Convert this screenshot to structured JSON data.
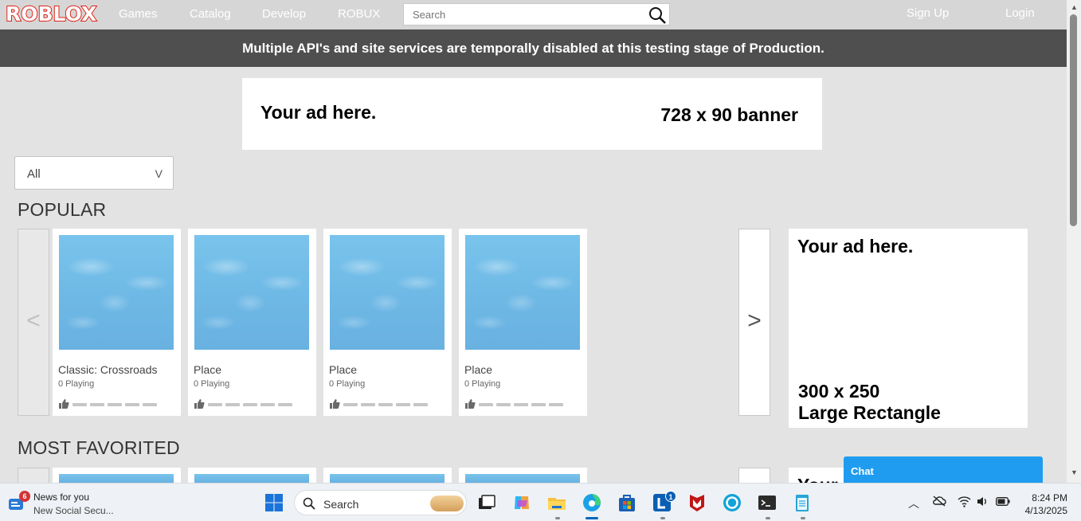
{
  "nav": {
    "logo": "ROBLOX",
    "links": [
      "Games",
      "Catalog",
      "Develop",
      "ROBUX"
    ],
    "search_placeholder": "Search",
    "signup": "Sign Up",
    "login": "Login"
  },
  "alert": "Multiple API's and site services are temporally disabled at this testing stage of Production.",
  "ad_banner": {
    "line1": "Your ad here.",
    "line2": "728 x 90 banner"
  },
  "ad_rect": {
    "line1": "Your ad here.",
    "line2": "300 x 250",
    "line3": "Large Rectangle"
  },
  "ad_rect2": {
    "line1": "Your ad here."
  },
  "filter": {
    "value": "All",
    "chevron": "V"
  },
  "sections": [
    {
      "title": "POPULAR",
      "prev": "<",
      "next": ">",
      "cards": [
        {
          "name": "Classic: Crossroads",
          "players": "0 Playing"
        },
        {
          "name": "Place",
          "players": "0 Playing"
        },
        {
          "name": "Place",
          "players": "0 Playing"
        },
        {
          "name": "Place",
          "players": "0 Playing"
        }
      ]
    },
    {
      "title": "MOST FAVORITED"
    }
  ],
  "chat": {
    "label": "Chat"
  },
  "taskbar": {
    "news_badge": "6",
    "news_title": "News for you",
    "news_sub": "New Social Secu...",
    "search": "Search",
    "app_badge": "1",
    "time": "8:24 PM",
    "date": "4/13/2025"
  }
}
